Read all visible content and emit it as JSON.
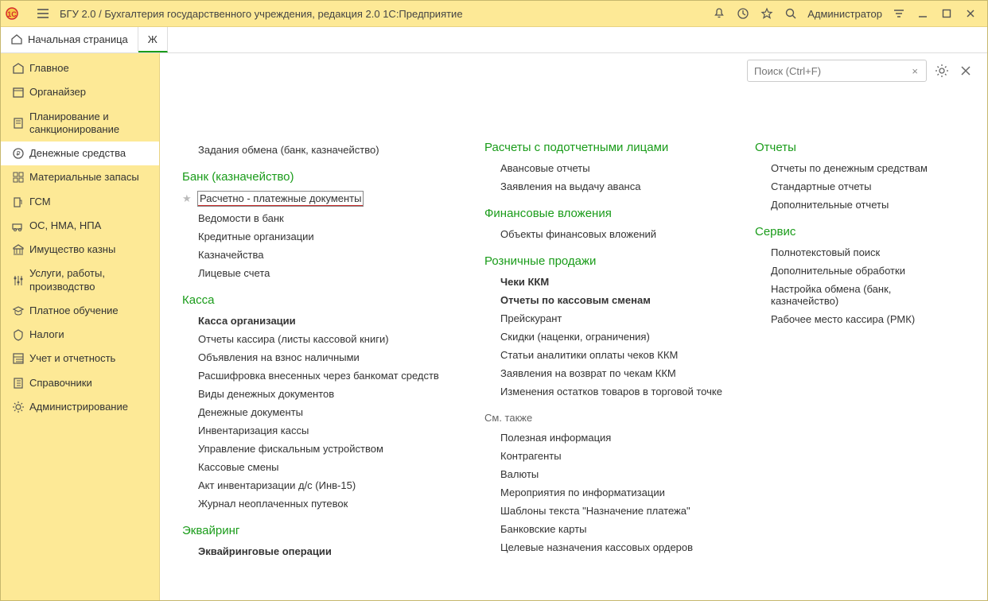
{
  "titlebar": {
    "title": "БГУ 2.0 / Бухгалтерия государственного учреждения, редакция 2.0 1С:Предприятие",
    "user": "Администратор"
  },
  "tabs": {
    "home": "Начальная страница",
    "second_prefix": "Ж"
  },
  "search": {
    "placeholder": "Поиск (Ctrl+F)"
  },
  "sidebar": [
    {
      "k": "main",
      "label": "Главное"
    },
    {
      "k": "organizer",
      "label": "Органайзер"
    },
    {
      "k": "planning",
      "label": "Планирование и санкционирование"
    },
    {
      "k": "money",
      "label": "Денежные средства",
      "active": true
    },
    {
      "k": "materials",
      "label": "Материальные запасы"
    },
    {
      "k": "gsm",
      "label": "ГСМ"
    },
    {
      "k": "os",
      "label": "ОС, НМА, НПА"
    },
    {
      "k": "treasury",
      "label": "Имущество казны"
    },
    {
      "k": "services",
      "label": "Услуги, работы, производство"
    },
    {
      "k": "education",
      "label": "Платное обучение"
    },
    {
      "k": "taxes",
      "label": "Налоги"
    },
    {
      "k": "accounting",
      "label": "Учет и отчетность"
    },
    {
      "k": "refs",
      "label": "Справочники"
    },
    {
      "k": "admin",
      "label": "Администрирование"
    }
  ],
  "col1": {
    "top_link": "Задания обмена (банк, казначейство)",
    "sec_bank": "Банк (казначейство)",
    "bank_items": [
      {
        "t": "Расчетно - платежные документы",
        "hl": true,
        "star": true
      },
      {
        "t": "Ведомости в банк"
      },
      {
        "t": "Кредитные организации"
      },
      {
        "t": "Казначейства"
      },
      {
        "t": "Лицевые счета"
      }
    ],
    "sec_kassa": "Касса",
    "kassa_items": [
      {
        "t": "Касса организации",
        "b": true
      },
      {
        "t": "Отчеты кассира (листы кассовой книги)"
      },
      {
        "t": "Объявления на взнос наличными"
      },
      {
        "t": "Расшифровка внесенных через банкомат средств"
      },
      {
        "t": "Виды денежных документов"
      },
      {
        "t": "Денежные документы"
      },
      {
        "t": "Инвентаризация кассы"
      },
      {
        "t": "Управление фискальным устройством"
      },
      {
        "t": "Кассовые смены"
      },
      {
        "t": "Акт инвентаризации д/с (Инв-15)"
      },
      {
        "t": "Журнал неоплаченных путевок"
      }
    ],
    "sec_acq": "Эквайринг",
    "acq_items": [
      {
        "t": "Эквайринговые операции",
        "b": true
      }
    ]
  },
  "col2": {
    "sec_podot": "Расчеты с подотчетными лицами",
    "podot_items": [
      {
        "t": "Авансовые отчеты"
      },
      {
        "t": "Заявления на выдачу аванса"
      }
    ],
    "sec_fin": "Финансовые вложения",
    "fin_items": [
      {
        "t": "Объекты финансовых вложений"
      }
    ],
    "sec_retail": "Розничные продажи",
    "retail_items": [
      {
        "t": "Чеки ККМ",
        "b": true
      },
      {
        "t": "Отчеты по кассовым сменам",
        "b": true
      },
      {
        "t": "Прейскурант"
      },
      {
        "t": "Скидки (наценки, ограничения)"
      },
      {
        "t": "Статьи аналитики оплаты чеков ККМ"
      },
      {
        "t": "Заявления на возврат по чекам ККМ"
      },
      {
        "t": "Изменения остатков товаров в торговой точке"
      }
    ],
    "sec_see": "См. также",
    "see_items": [
      {
        "t": "Полезная информация"
      },
      {
        "t": "Контрагенты"
      },
      {
        "t": "Валюты"
      },
      {
        "t": "Мероприятия по информатизации"
      },
      {
        "t": "Шаблоны текста \"Назначение платежа\""
      },
      {
        "t": "Банковские карты"
      },
      {
        "t": "Целевые назначения кассовых ордеров"
      }
    ]
  },
  "col3": {
    "sec_reports": "Отчеты",
    "reports_items": [
      {
        "t": "Отчеты по денежным средствам"
      },
      {
        "t": "Стандартные отчеты"
      },
      {
        "t": "Дополнительные отчеты"
      }
    ],
    "sec_service": "Сервис",
    "service_items": [
      {
        "t": "Полнотекстовый поиск"
      },
      {
        "t": "Дополнительные обработки"
      },
      {
        "t": "Настройка обмена (банк, казначейство)"
      },
      {
        "t": "Рабочее место кассира (РМК)"
      }
    ]
  }
}
